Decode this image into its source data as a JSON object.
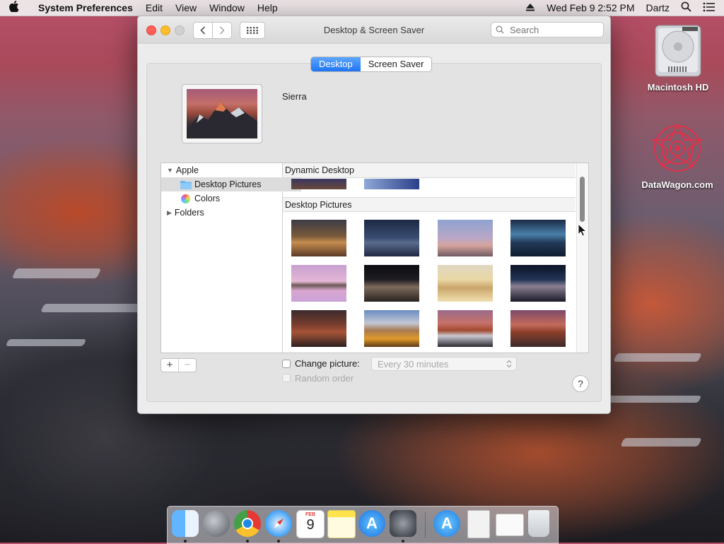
{
  "menubar": {
    "app_name": "System Preferences",
    "menus": [
      "Edit",
      "View",
      "Window",
      "Help"
    ],
    "clock": "Wed Feb 9  2:52 PM",
    "user": "Dartz"
  },
  "window": {
    "title": "Desktop & Screen Saver",
    "search_placeholder": "Search",
    "tabs": [
      "Desktop",
      "Screen Saver"
    ],
    "active_tab": "Desktop",
    "current_picture_name": "Sierra",
    "sidebar": {
      "group": "Apple",
      "items": [
        "Desktop Pictures",
        "Colors"
      ],
      "selected": "Desktop Pictures",
      "folders": "Folders"
    },
    "sections": {
      "dynamic": "Dynamic Desktop",
      "pictures": "Desktop Pictures"
    },
    "change_picture_label": "Change picture:",
    "interval": "Every 30 minutes",
    "random_order_label": "Random order",
    "help": "?"
  },
  "desktop_icons": {
    "hd": "Macintosh HD",
    "site": "DataWagon.com"
  },
  "calendar_day": "9",
  "calendar_month": "FEB"
}
